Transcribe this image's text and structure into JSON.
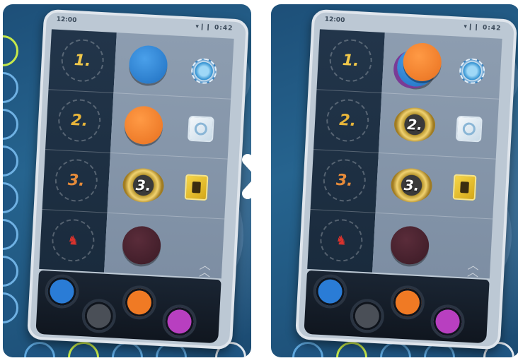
{
  "colors": {
    "board_blue": "#1d4f78",
    "token_blue": "#2a7cd6",
    "token_orange": "#f07a24",
    "token_grey": "#4a4f57",
    "token_purple": "#b83fc0",
    "rank_gold": "#f0c84a",
    "rank_red": "#d8332d"
  },
  "panels": [
    {
      "status": {
        "time": "12:00",
        "signal": "▾❙❙ 0:42"
      },
      "ranks": [
        "1.",
        "2.",
        "3.",
        "♞"
      ],
      "rows": [
        {
          "token": "blue disc",
          "badge": "gear-icon"
        },
        {
          "token": "orange disc",
          "badge": "shield-icon"
        },
        {
          "token": "laurel",
          "laurel_label": "3.",
          "badge": "chip-icon"
        },
        {
          "token": "dark disc",
          "badge": ""
        }
      ],
      "tray": [
        "blue",
        "grey",
        "orange",
        "purple"
      ]
    },
    {
      "status": {
        "time": "12:00",
        "signal": "▾❙❙ 0:42"
      },
      "ranks": [
        "1.",
        "2.",
        "3.",
        "♞"
      ],
      "rows": [
        {
          "token": "stacked blue+orange disc",
          "badge": "gear-icon"
        },
        {
          "token": "laurel",
          "laurel_label": "2.",
          "badge": "shield-icon"
        },
        {
          "token": "laurel",
          "laurel_label": "3.",
          "badge": "chip-icon"
        },
        {
          "token": "dark disc",
          "badge": ""
        }
      ],
      "tray": [
        "blue",
        "grey",
        "orange",
        "purple"
      ]
    }
  ],
  "transition_icon": "double-chevron-right-icon"
}
